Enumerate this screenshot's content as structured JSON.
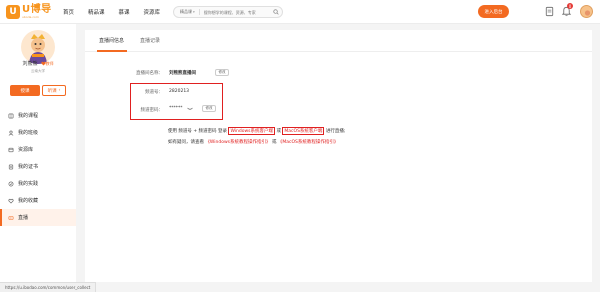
{
  "header": {
    "logo_mark": "U",
    "logo_name": "U博导",
    "logo_url": "uboda.com",
    "nav": [
      "首页",
      "精品课",
      "慕课",
      "资源库"
    ],
    "search": {
      "category": "精品课",
      "placeholder": "搜你想学的课程、资源、专家"
    },
    "cta_label": "进入后台",
    "bell_count": "0"
  },
  "sidebar": {
    "username": "刘熊熊",
    "user_badge": "教师",
    "school": "云南大学",
    "btn_primary": "授课",
    "btn_secondary": "听课",
    "menu": [
      {
        "label": "我的课程",
        "icon": "book-icon"
      },
      {
        "label": "我的班级",
        "icon": "class-icon"
      },
      {
        "label": "资源库",
        "icon": "resource-icon"
      },
      {
        "label": "我的证书",
        "icon": "certificate-icon"
      },
      {
        "label": "我的实践",
        "icon": "practice-icon"
      },
      {
        "label": "我的收藏",
        "icon": "heart-icon"
      },
      {
        "label": "直播",
        "icon": "live-icon",
        "active": true
      }
    ]
  },
  "main": {
    "tabs": [
      "直播间信息",
      "直播记录"
    ],
    "room_name_label": "直播间名称：",
    "room_name_value": "刘熊熊直播间",
    "edit_label": "修改",
    "channel_label": "频道号：",
    "channel_value": "2820213",
    "password_label": "频道密码：",
    "password_value": "******",
    "password_btn": "修改",
    "instr": {
      "line1_pre": "使用 频道号 + 频道密码 登录",
      "win_client": "Windows系统客户端",
      "or": "或",
      "mac_client": "MacOS系统客户端",
      "line1_post": "进行直播;",
      "line2_pre": "如有疑问，请查看",
      "win_guide": "《Windows系统教程操作指引》",
      "or2": "或",
      "mac_guide": "《MacOS系统教程操作指引》"
    }
  },
  "statusbar": {
    "url": "https://u.ibodao.com/common/user_collect"
  },
  "colors": {
    "accent": "#f36a21",
    "highlight": "#e02020"
  }
}
